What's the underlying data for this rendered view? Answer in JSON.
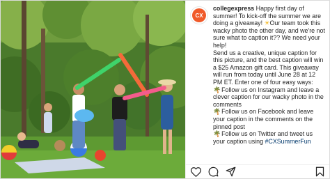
{
  "post": {
    "username": "collegexpress",
    "avatar_text": "CX",
    "caption_intro": "Happy first day of summer! To kick-off the summer we are doing a giveaway!",
    "caption_sun": "☀",
    "caption_intro_2": "Our team took this wacky photo the other day, and we're not sure what to caption it?? We need your help!",
    "caption_body": "Send us a creative, unique caption for this picture, and the best caption will win a $25 Amazon gift card. This giveaway will run from today until June 28 at 12 PM ET. Enter one of four easy ways:",
    "bullet_icon": "🌴",
    "bullets": [
      "Follow us on Instagram and leave a clever caption for our wacky photo in the comments",
      "Follow us on Facebook and leave your caption in the comments on the pinned post",
      "Follow us on Twitter and tweet us"
    ],
    "last_line_prefix": "your caption using ",
    "last_line_hashtag": "#CXSummerFun"
  },
  "actions": {
    "like_icon": "heart-icon",
    "comment_icon": "comment-icon",
    "share_icon": "share-icon",
    "save_icon": "bookmark-icon"
  },
  "colors": {
    "brand": "#f05a2a",
    "text": "#262626",
    "hashtag": "#00376b"
  }
}
